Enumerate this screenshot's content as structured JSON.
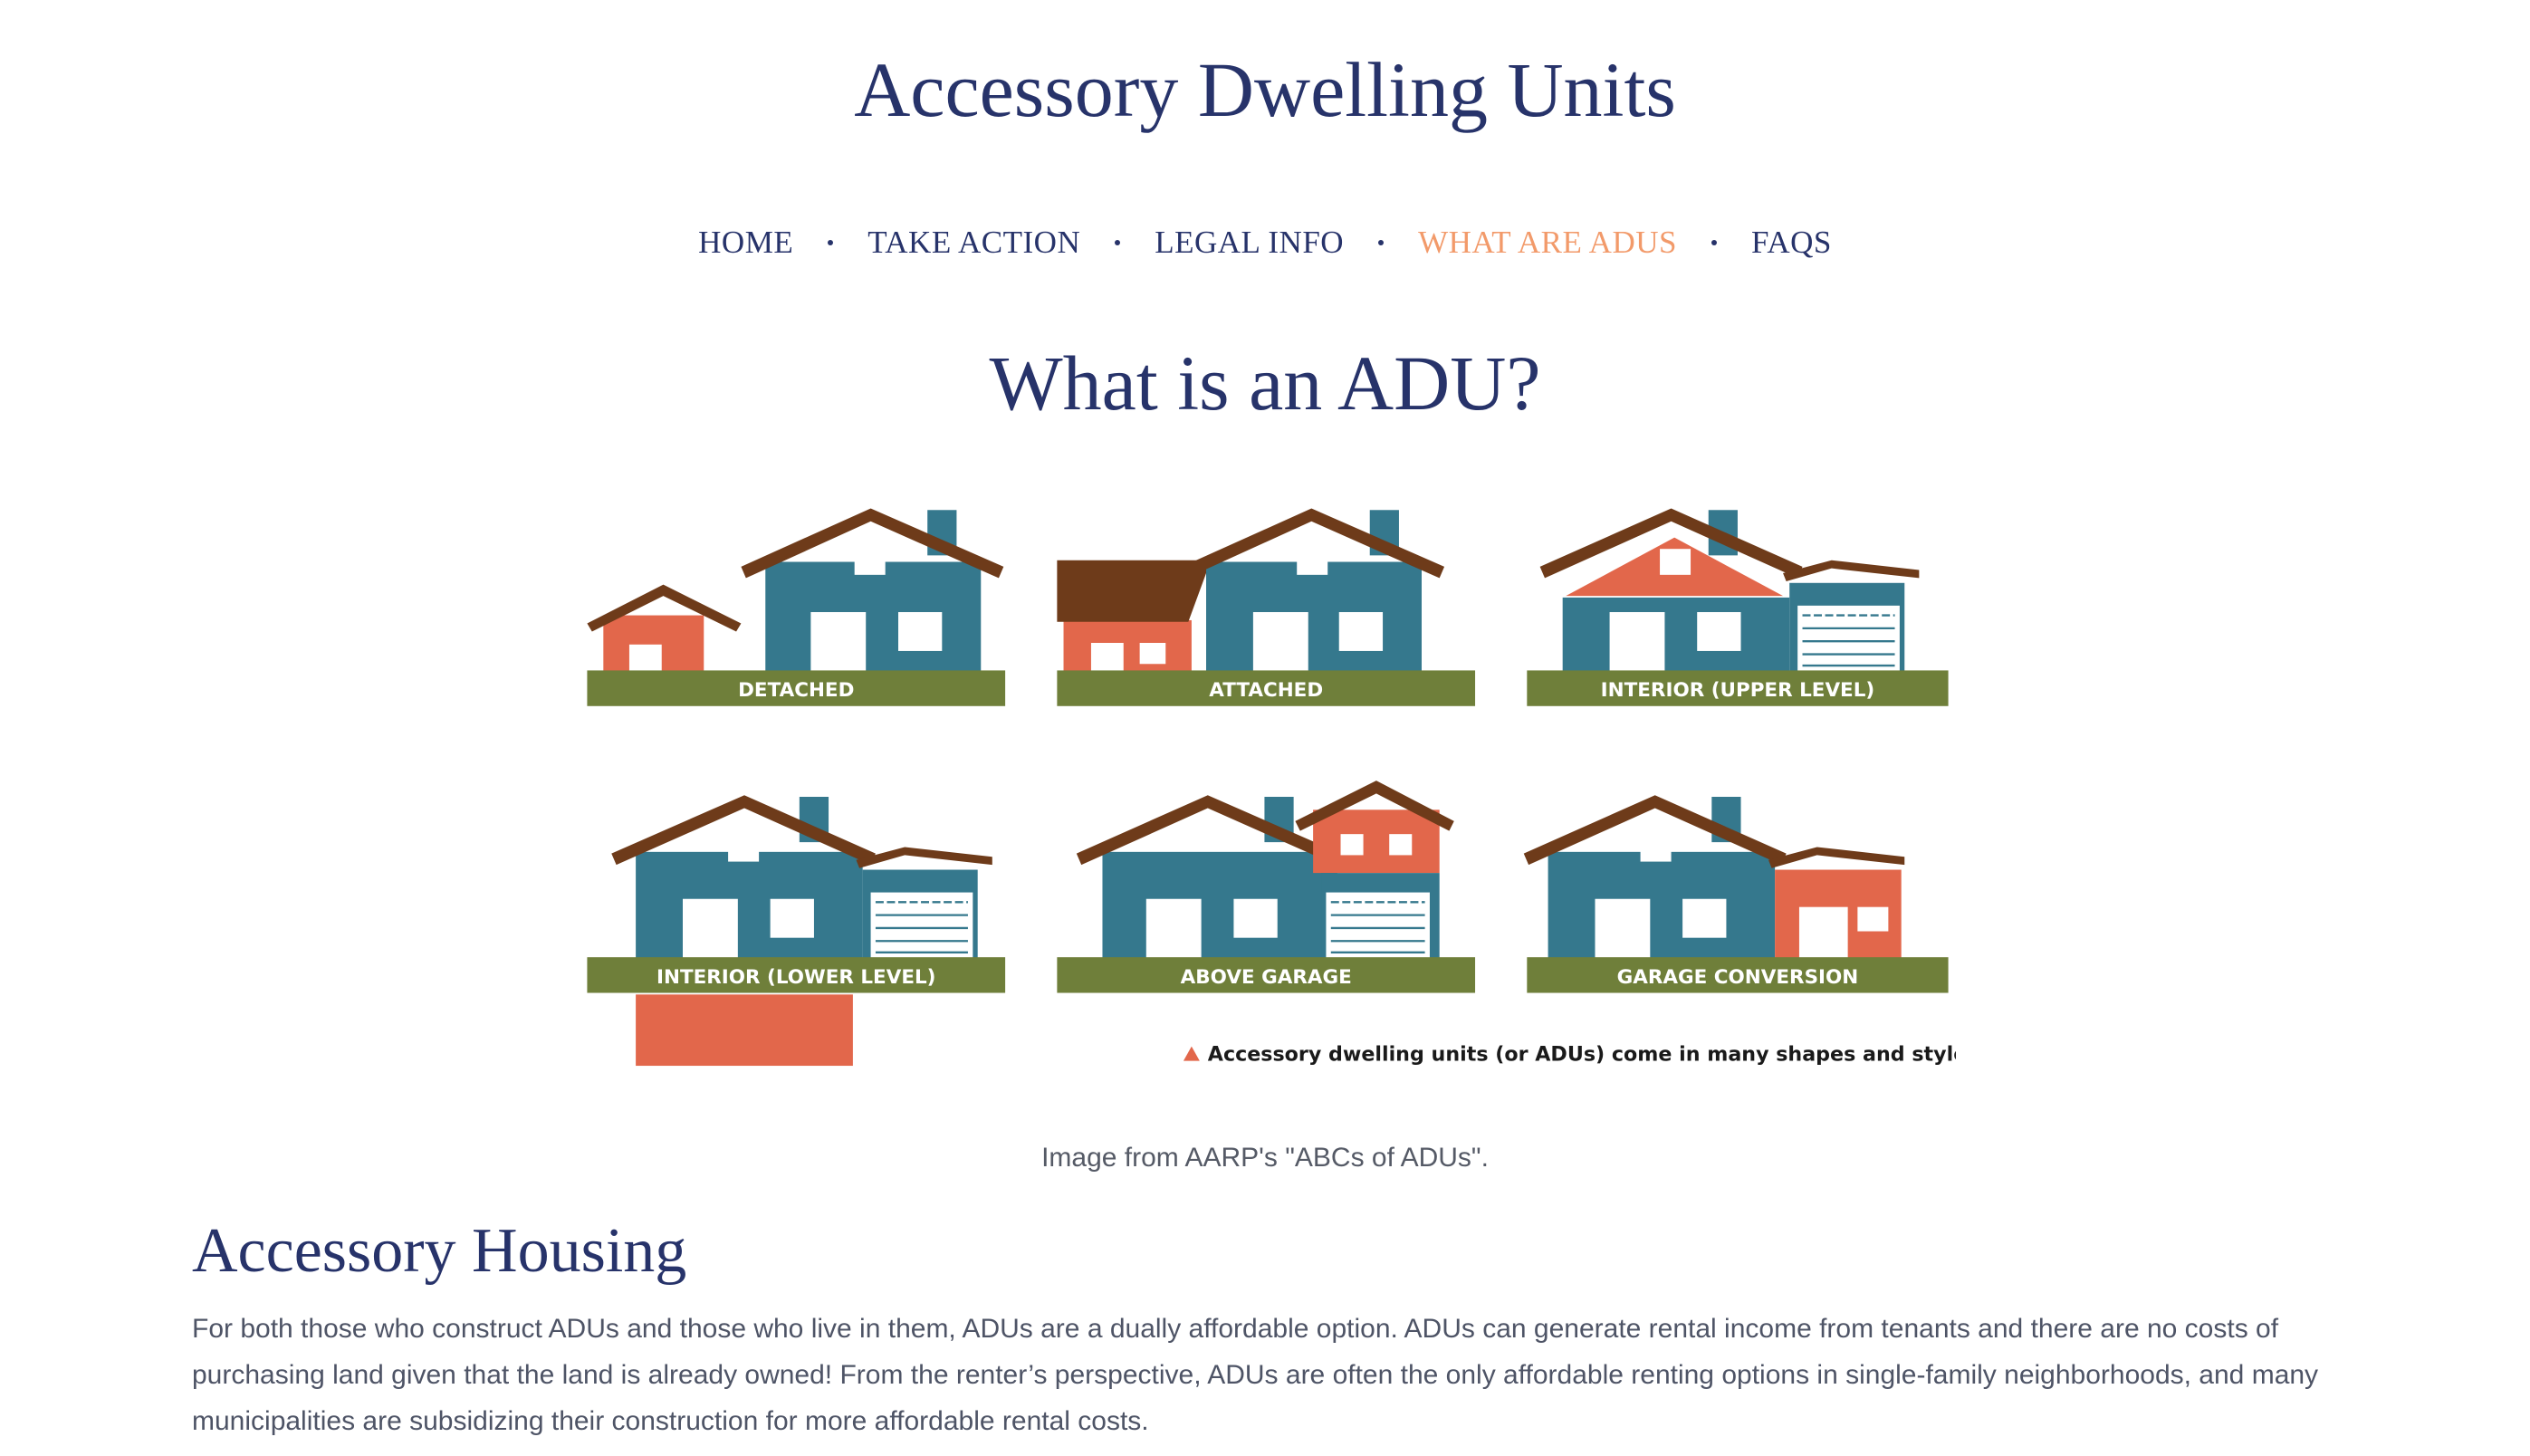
{
  "site": {
    "title": "Accessory Dwelling Units"
  },
  "nav": {
    "items": [
      {
        "label": "HOME"
      },
      {
        "label": "TAKE ACTION"
      },
      {
        "label": "LEGAL INFO"
      },
      {
        "label": "WHAT ARE ADUS",
        "active": true
      },
      {
        "label": "FAQS"
      }
    ]
  },
  "page": {
    "heading": "What is an ADU?"
  },
  "figure": {
    "labels": [
      "DETACHED",
      "ATTACHED",
      "INTERIOR (UPPER LEVEL)",
      "INTERIOR (LOWER LEVEL)",
      "ABOVE GARAGE",
      "GARAGE CONVERSION"
    ],
    "legend": "Accessory dwelling units (or ADUs) come in many shapes and styles.",
    "colors": {
      "main_house": "#35788d",
      "adu": "#e2674b",
      "roof": "#6e3b1a",
      "ground": "#6f7f3a",
      "window": "#ffffff",
      "legend_text": "#1a1a1a"
    },
    "caption": "Image from AARP's \"ABCs of ADUs\"."
  },
  "section": {
    "heading": "Accessory Housing",
    "body": "For both those who construct ADUs and those who live in them, ADUs are a dually affordable option. ADUs can generate rental income from tenants and there are no costs of purchasing land given that the land is already owned! From the renter’s perspective, ADUs are often the only affordable renting options in single-family neighborhoods, and many municipalities are subsidizing their construction for more affordable rental costs."
  },
  "theme": {
    "primary": "#27336a",
    "accent": "#f29a6a",
    "body_text": "#4e5466"
  }
}
